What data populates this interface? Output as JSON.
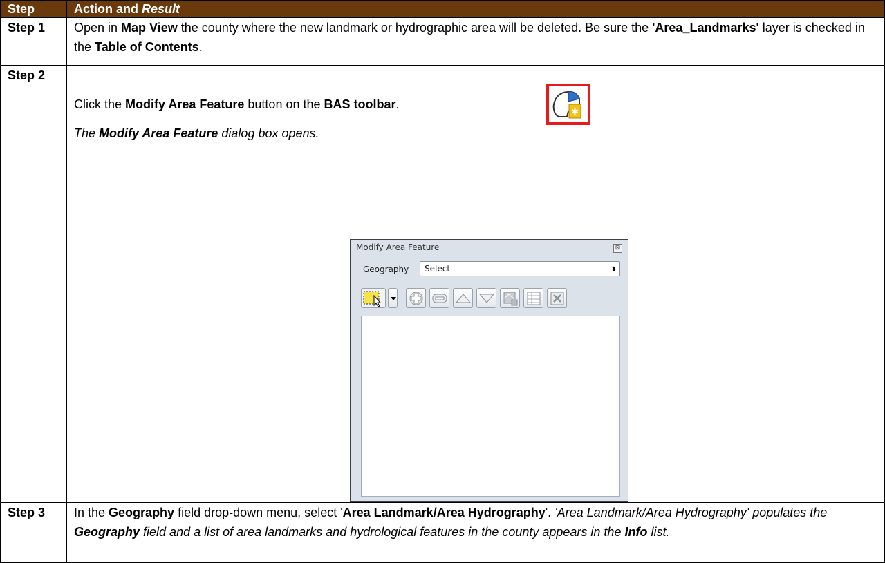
{
  "header": {
    "step": "Step",
    "action_prefix": "Action and ",
    "action_result": "Result"
  },
  "steps": [
    {
      "label": "Step 1",
      "t1": "Open in ",
      "b1": "Map View",
      "t2": " the county where the new landmark or hydrographic area will be deleted. Be sure the ",
      "b2": "'Area_Landmarks'",
      "t3": " layer is checked in the ",
      "b3": "Table of Contents",
      "t4": "."
    },
    {
      "label": "Step 2",
      "t1": "Click the ",
      "b1": "Modify Area Feature",
      "t2": " button on the ",
      "b2": "BAS toolbar",
      "t3": ".",
      "r1": "The ",
      "r2": "Modify Area Feature",
      "r3": " dialog box opens."
    },
    {
      "label": "Step 3",
      "t1": "In the ",
      "b1": "Geography",
      "t2": " field drop-down menu, select '",
      "b2": "Area Landmark/Area Hydrography",
      "t3": "'. ",
      "i1": "'Area Landmark/Area Hydrography' populates the ",
      "ib1": "Geography",
      "i2": " field and a list of area landmarks and hydrological features in the county appears in the ",
      "ib2": "Info",
      "i3": " list."
    }
  ],
  "dialog": {
    "title": "Modify Area Feature",
    "close_glyph": "⊠",
    "geography_label": "Geography",
    "geography_value": "Select",
    "select_arrow": "⬍"
  },
  "icons": {
    "toolbar_button": "modify-area-feature-icon",
    "tools": [
      "select-features-icon",
      "dropdown-arrow-icon",
      "add-icon",
      "remove-icon",
      "move-up-icon",
      "move-down-icon",
      "map-zoom-icon",
      "attribute-table-icon",
      "clear-icon"
    ]
  },
  "colors": {
    "header_bg": "#6b3a0c",
    "highlight_border": "#e51c1c"
  }
}
